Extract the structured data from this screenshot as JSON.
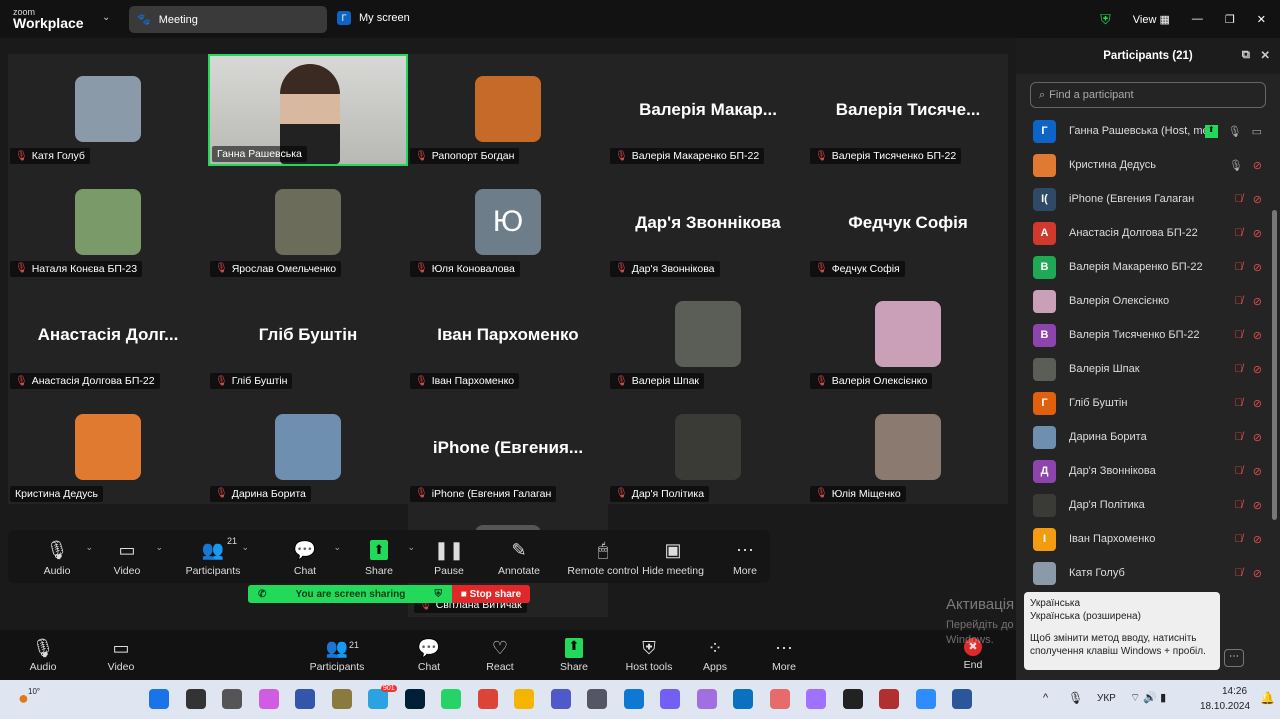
{
  "app": {
    "logo_top": "zoom",
    "logo_bottom": "Workplace",
    "tab_meeting": "Meeting",
    "tab_screen": "My screen",
    "tab_screen_initial": "Г",
    "view": "View"
  },
  "tiles": [
    {
      "name": "Катя Голуб",
      "type": "photo",
      "color": "#8a9aa8",
      "muted": true
    },
    {
      "name": "Ганна Рашевська",
      "type": "video",
      "color": "#cfcfcf",
      "muted": false
    },
    {
      "name": "Рапопорт Богдан",
      "type": "photo",
      "color": "#c66a2a",
      "muted": true
    },
    {
      "name": "Валерія Макаренко БП-22",
      "big": "Валерія  Макар...",
      "type": "text",
      "muted": true
    },
    {
      "name": "Валерія Тисяченко БП-22",
      "big": "Валерія  Тисяче...",
      "type": "text",
      "muted": true
    },
    {
      "name": "Наталя Конєва БП-23",
      "type": "photo",
      "color": "#7a9a6a",
      "muted": true
    },
    {
      "name": "Ярослав Омельченко",
      "type": "photo",
      "color": "#6c6c5a",
      "muted": true
    },
    {
      "name": "Юля Коновалова",
      "type": "initial",
      "initial": "Ю",
      "color": "#6d7e8a",
      "muted": true
    },
    {
      "name": "Дар'я Звоннікова",
      "big": "Дар'я Звоннікова",
      "type": "text",
      "muted": true
    },
    {
      "name": "Федчук Софія",
      "big": "Федчук Софія",
      "type": "text",
      "muted": true
    },
    {
      "name": "Анастасія Долгова БП-22",
      "big": "Анастасія  Долг...",
      "type": "text",
      "muted": true
    },
    {
      "name": "Гліб Буштін",
      "big": "Гліб Буштін",
      "type": "text",
      "muted": true
    },
    {
      "name": "Іван Пархоменко",
      "big": "Іван Пархоменко",
      "type": "text",
      "muted": true
    },
    {
      "name": "Валерія Шпак",
      "type": "photo",
      "color": "#5a5e56",
      "muted": true
    },
    {
      "name": "Валерія Олексієнко",
      "type": "photo",
      "color": "#c9a0b8",
      "muted": true
    },
    {
      "name": "Кристина Дедусь",
      "type": "photo",
      "color": "#e07a30",
      "muted": false
    },
    {
      "name": "Дарина Борита",
      "type": "photo",
      "color": "#6f8fb0",
      "muted": true
    },
    {
      "name": "iPhone (Евгения Галаган",
      "big": "iPhone  (Евгения...",
      "type": "text",
      "muted": true
    },
    {
      "name": "Дар'я Політика",
      "type": "photo",
      "color": "#3a3a36",
      "muted": true
    },
    {
      "name": "Юлія Міщенко",
      "type": "photo",
      "color": "#8a7a70",
      "muted": true
    }
  ],
  "extra_tile": {
    "name": "Світлана Витичак"
  },
  "share_toolbar": [
    {
      "label": "Audio",
      "icon": "microphone-icon",
      "glyph": "🎙",
      "chev": true
    },
    {
      "label": "Video",
      "icon": "video-camera-icon",
      "glyph": "▭",
      "chev": true
    },
    {
      "label": "Participants",
      "icon": "participants-icon",
      "glyph": "👥",
      "badge": "21",
      "chev": true
    },
    {
      "label": "Chat",
      "icon": "chat-icon",
      "glyph": "💬",
      "chev": true
    },
    {
      "label": "Share",
      "icon": "share-screen-icon",
      "glyph": "⬆",
      "chev": true
    },
    {
      "label": "Pause",
      "icon": "pause-icon",
      "glyph": "❚❚"
    },
    {
      "label": "Annotate",
      "icon": "pencil-icon",
      "glyph": "✎"
    },
    {
      "label": "Remote control",
      "icon": "mouse-icon",
      "glyph": "🖱"
    },
    {
      "label": "Hide meeting",
      "icon": "hide-meeting-icon",
      "glyph": "▣"
    },
    {
      "label": "More",
      "icon": "more-icon",
      "glyph": "⋯"
    }
  ],
  "banner": {
    "text": "You are screen sharing",
    "stop": "Stop share"
  },
  "bottom_toolbar": [
    {
      "label": "Audio",
      "icon": "microphone-icon",
      "glyph": "🎙"
    },
    {
      "label": "Video",
      "icon": "video-camera-icon",
      "glyph": "▭"
    },
    {
      "label": "Participants",
      "icon": "participants-icon",
      "glyph": "👥",
      "badge": "21"
    },
    {
      "label": "Chat",
      "icon": "chat-icon",
      "glyph": "💬"
    },
    {
      "label": "React",
      "icon": "heart-icon",
      "glyph": "♡"
    },
    {
      "label": "Share",
      "icon": "share-screen-icon",
      "glyph": "⬆"
    },
    {
      "label": "Host tools",
      "icon": "shield-icon",
      "glyph": "⛨"
    },
    {
      "label": "Apps",
      "icon": "apps-icon",
      "glyph": "⁘"
    },
    {
      "label": "More",
      "icon": "more-icon",
      "glyph": "⋯"
    },
    {
      "label": "End",
      "icon": "end-call-icon",
      "glyph": "✖"
    }
  ],
  "panel": {
    "title": "Participants (21)",
    "search_placeholder": "Find a participant",
    "participants": [
      {
        "name": "Ганна Рашевська (Host, me)",
        "initial": "Г",
        "color": "#0e63c7",
        "host": true
      },
      {
        "name": "Кристина Дедусь",
        "initial": "",
        "color": "#e07a30",
        "mic_on": true
      },
      {
        "name": "iPhone (Евгения Галаган",
        "initial": "I(",
        "color": "#2e4a66"
      },
      {
        "name": "Анастасія Долгова БП-22",
        "initial": "А",
        "color": "#d0392b"
      },
      {
        "name": "Валерія Макаренко БП-22",
        "initial": "В",
        "color": "#1fa855"
      },
      {
        "name": "Валерія Олексієнко",
        "initial": "",
        "color": "#c9a0b8"
      },
      {
        "name": "Валерія Тисяченко БП-22",
        "initial": "В",
        "color": "#8e44ad"
      },
      {
        "name": "Валерія Шпак",
        "initial": "",
        "color": "#5a5e56"
      },
      {
        "name": "Гліб Буштін",
        "initial": "Г",
        "color": "#e0600e"
      },
      {
        "name": "Дарина Борита",
        "initial": "",
        "color": "#6f8fb0"
      },
      {
        "name": "Дар'я Звоннікова",
        "initial": "Д",
        "color": "#8e44ad"
      },
      {
        "name": "Дар'я Політика",
        "initial": "",
        "color": "#3a3a36"
      },
      {
        "name": "Іван Пархоменко",
        "initial": "І",
        "color": "#f39c12"
      },
      {
        "name": "Катя Голуб",
        "initial": "",
        "color": "#8a9aa8"
      }
    ]
  },
  "watermark": {
    "title": "Активація Windows",
    "text": "Перейдіть до розділу \"Настройки\", щоб активувати Windows."
  },
  "tooltip": {
    "line1": "Українська",
    "line2": "Українська (розширена)",
    "line3": "Щоб змінити метод вводу, натисніть сполучення клавіш Windows + пробіл."
  },
  "taskbar": {
    "weather": "10°",
    "lang": "УКР",
    "time": "14:26",
    "date": "18.10.2024",
    "telegram_badge": "901"
  },
  "colors": {
    "accent_green": "#23d959",
    "stop_red": "#e02828",
    "muted_red": "#e04b4b"
  }
}
